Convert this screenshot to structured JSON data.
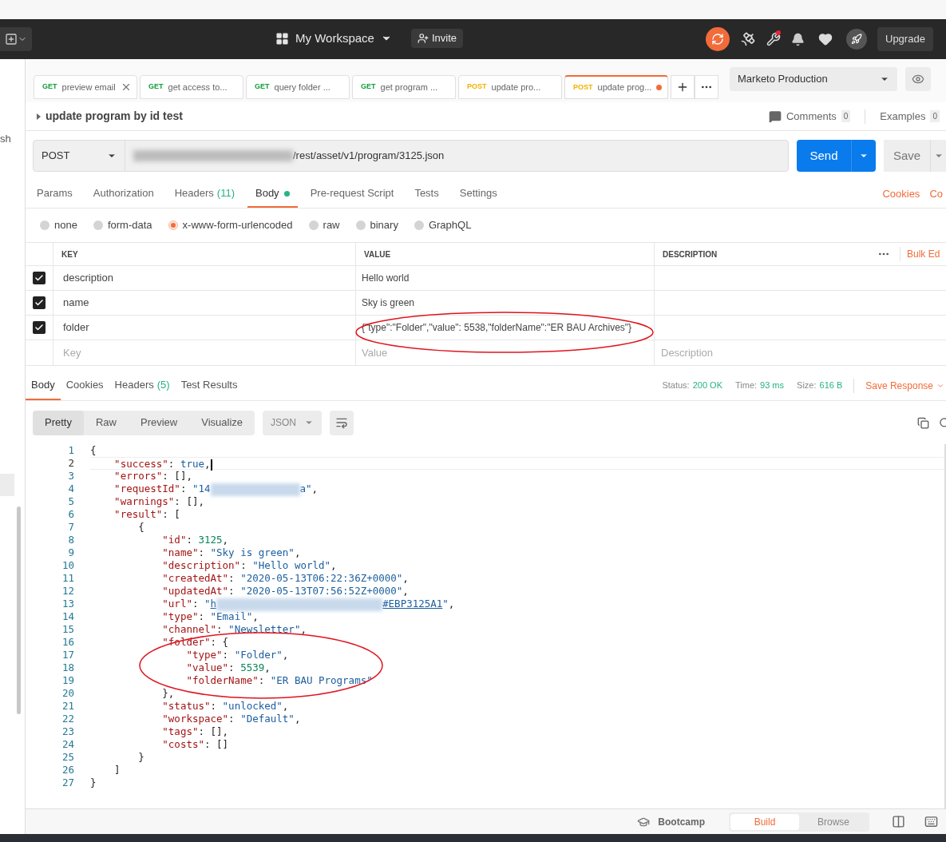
{
  "header": {
    "workspace": "My Workspace",
    "invite": "Invite",
    "upgrade": "Upgrade"
  },
  "sidebar": {
    "text": "sh"
  },
  "tabs": [
    {
      "method": "GET",
      "color": "#0e9f3a",
      "title": "preview email",
      "selected": false,
      "closable": true,
      "unsaved": false
    },
    {
      "method": "GET",
      "color": "#0e9f3a",
      "title": "get access to...",
      "selected": false,
      "closable": false,
      "unsaved": false
    },
    {
      "method": "GET",
      "color": "#0e9f3a",
      "title": "query folder ...",
      "selected": false,
      "closable": false,
      "unsaved": false
    },
    {
      "method": "GET",
      "color": "#0e9f3a",
      "title": "get program ...",
      "selected": false,
      "closable": false,
      "unsaved": false
    },
    {
      "method": "POST",
      "color": "#f2b200",
      "title": "update pro...",
      "selected": false,
      "closable": false,
      "unsaved": false
    },
    {
      "method": "POST",
      "color": "#f2b200",
      "title": "update prog...",
      "selected": true,
      "closable": false,
      "unsaved": true
    }
  ],
  "environment": "Marketo Production",
  "request": {
    "name": "update program by id test",
    "comments": "Comments",
    "comments_count": "0",
    "examples": "Examples",
    "examples_count": "0",
    "method": "POST",
    "url": "/rest/asset/v1/program/3125.json",
    "send": "Send",
    "save": "Save"
  },
  "request_tabs": [
    {
      "label": "Params",
      "selected": false
    },
    {
      "label": "Authorization",
      "selected": false
    },
    {
      "label": "Headers",
      "count": "(11)",
      "selected": false
    },
    {
      "label": "Body",
      "dot": true,
      "selected": true
    },
    {
      "label": "Pre-request Script",
      "selected": false
    },
    {
      "label": "Tests",
      "selected": false
    },
    {
      "label": "Settings",
      "selected": false
    }
  ],
  "links": [
    "Cookies",
    "Co"
  ],
  "body_types": [
    {
      "label": "none",
      "selected": false
    },
    {
      "label": "form-data",
      "selected": false
    },
    {
      "label": "x-www-form-urlencoded",
      "selected": true
    },
    {
      "label": "raw",
      "selected": false
    },
    {
      "label": "binary",
      "selected": false
    },
    {
      "label": "GraphQL",
      "selected": false
    }
  ],
  "params": {
    "columns": [
      "KEY",
      "VALUE",
      "DESCRIPTION"
    ],
    "bulk_edit": "Bulk Ed",
    "rows": [
      {
        "key": "description",
        "value": "Hello world",
        "checked": true
      },
      {
        "key": "name",
        "value": "Sky is green",
        "checked": true
      },
      {
        "key": "folder",
        "value": "{\"type\":\"Folder\",\"value\": 5538,\"folderName\":\"ER BAU Archives\"}",
        "checked": true
      }
    ],
    "new_row": [
      {
        "placeholder": "Key"
      },
      {
        "placeholder": "Value"
      },
      {
        "placeholder": "Description"
      }
    ]
  },
  "response": {
    "tabs": [
      {
        "label": "Body",
        "selected": true
      },
      {
        "label": "Cookies",
        "selected": false
      },
      {
        "label": "Headers",
        "count": "(5)",
        "selected": false
      },
      {
        "label": "Test Results",
        "selected": false
      }
    ],
    "status_label": "Status:",
    "status": "200 OK",
    "time_label": "Time:",
    "time": "93 ms",
    "size_label": "Size:",
    "size": "616 B",
    "save": "Save Response",
    "views": [
      {
        "label": "Pretty",
        "selected": true
      },
      {
        "label": "Raw",
        "selected": false
      },
      {
        "label": "Preview",
        "selected": false
      },
      {
        "label": "Visualize",
        "selected": false
      }
    ],
    "format": "JSON",
    "lines": [
      {
        "number": "1",
        "active": false,
        "tokens": [
          {
            "kind": "punct",
            "text": "{"
          }
        ]
      },
      {
        "number": "2",
        "active": true,
        "tokens": [
          {
            "kind": "key",
            "text": "    \"success\""
          },
          {
            "kind": "punct",
            "text": ": "
          },
          {
            "kind": "bool",
            "text": "true"
          },
          {
            "kind": "punct",
            "text": ","
          }
        ]
      },
      {
        "number": "3",
        "active": false,
        "tokens": [
          {
            "kind": "key",
            "text": "    \"errors\""
          },
          {
            "kind": "punct",
            "text": ": [],"
          }
        ]
      },
      {
        "number": "4",
        "active": false,
        "tokens": [
          {
            "kind": "key",
            "text": "    \"requestId\""
          },
          {
            "kind": "punct",
            "text": ": "
          },
          {
            "kind": "string",
            "text": "\"14"
          },
          {
            "kind": "redacted"
          },
          {
            "kind": "string",
            "text": "a\""
          },
          {
            "kind": "punct",
            "text": ","
          }
        ]
      },
      {
        "number": "5",
        "active": false,
        "tokens": [
          {
            "kind": "key",
            "text": "    \"warnings\""
          },
          {
            "kind": "punct",
            "text": ": [],"
          }
        ]
      },
      {
        "number": "6",
        "active": false,
        "tokens": [
          {
            "kind": "key",
            "text": "    \"result\""
          },
          {
            "kind": "punct",
            "text": ": ["
          }
        ]
      },
      {
        "number": "7",
        "active": false,
        "tokens": [
          {
            "kind": "punct",
            "text": "        {"
          }
        ]
      },
      {
        "number": "8",
        "active": false,
        "tokens": [
          {
            "kind": "key",
            "text": "            \"id\""
          },
          {
            "kind": "punct",
            "text": ": "
          },
          {
            "kind": "number",
            "text": "3125"
          },
          {
            "kind": "punct",
            "text": ","
          }
        ]
      },
      {
        "number": "9",
        "active": false,
        "tokens": [
          {
            "kind": "key",
            "text": "            \"name\""
          },
          {
            "kind": "punct",
            "text": ": "
          },
          {
            "kind": "string",
            "text": "\"Sky is green\""
          },
          {
            "kind": "punct",
            "text": ","
          }
        ]
      },
      {
        "number": "10",
        "active": false,
        "tokens": [
          {
            "kind": "key",
            "text": "            \"description\""
          },
          {
            "kind": "punct",
            "text": ": "
          },
          {
            "kind": "string",
            "text": "\"Hello world\""
          },
          {
            "kind": "punct",
            "text": ","
          }
        ]
      },
      {
        "number": "11",
        "active": false,
        "tokens": [
          {
            "kind": "key",
            "text": "            \"createdAt\""
          },
          {
            "kind": "punct",
            "text": ": "
          },
          {
            "kind": "string",
            "text": "\"2020-05-13T06:22:36Z+0000\""
          },
          {
            "kind": "punct",
            "text": ","
          }
        ]
      },
      {
        "number": "12",
        "active": false,
        "tokens": [
          {
            "kind": "key",
            "text": "            \"updatedAt\""
          },
          {
            "kind": "punct",
            "text": ": "
          },
          {
            "kind": "string",
            "text": "\"2020-05-13T07:56:52Z+0000\""
          },
          {
            "kind": "punct",
            "text": ","
          }
        ]
      },
      {
        "number": "13",
        "active": false,
        "tokens": [
          {
            "kind": "key",
            "text": "            \"url\""
          },
          {
            "kind": "punct",
            "text": ": "
          },
          {
            "kind": "string",
            "text": "\""
          },
          {
            "kind": "link",
            "text": "h"
          },
          {
            "kind": "redacted_link"
          },
          {
            "kind": "link",
            "text": "#EBP3125A1"
          },
          {
            "kind": "string",
            "text": "\""
          },
          {
            "kind": "punct",
            "text": ","
          }
        ]
      },
      {
        "number": "14",
        "active": false,
        "tokens": [
          {
            "kind": "key",
            "text": "            \"type\""
          },
          {
            "kind": "punct",
            "text": ": "
          },
          {
            "kind": "string",
            "text": "\"Email\""
          },
          {
            "kind": "punct",
            "text": ","
          }
        ]
      },
      {
        "number": "15",
        "active": false,
        "tokens": [
          {
            "kind": "key",
            "text": "            \"channel\""
          },
          {
            "kind": "punct",
            "text": ": "
          },
          {
            "kind": "string",
            "text": "\"Newsletter\""
          },
          {
            "kind": "punct",
            "text": ","
          }
        ]
      },
      {
        "number": "16",
        "active": false,
        "tokens": [
          {
            "kind": "key",
            "text": "            \"folder\""
          },
          {
            "kind": "punct",
            "text": ": {"
          }
        ]
      },
      {
        "number": "17",
        "active": false,
        "tokens": [
          {
            "kind": "key",
            "text": "                \"type\""
          },
          {
            "kind": "punct",
            "text": ": "
          },
          {
            "kind": "string",
            "text": "\"Folder\""
          },
          {
            "kind": "punct",
            "text": ","
          }
        ]
      },
      {
        "number": "18",
        "active": false,
        "tokens": [
          {
            "kind": "key",
            "text": "                \"value\""
          },
          {
            "kind": "punct",
            "text": ": "
          },
          {
            "kind": "number",
            "text": "5539"
          },
          {
            "kind": "punct",
            "text": ","
          }
        ]
      },
      {
        "number": "19",
        "active": false,
        "tokens": [
          {
            "kind": "key",
            "text": "                \"folderName\""
          },
          {
            "kind": "punct",
            "text": ": "
          },
          {
            "kind": "string",
            "text": "\"ER BAU Programs\""
          }
        ]
      },
      {
        "number": "20",
        "active": false,
        "tokens": [
          {
            "kind": "punct",
            "text": "            },"
          }
        ]
      },
      {
        "number": "21",
        "active": false,
        "tokens": [
          {
            "kind": "key",
            "text": "            \"status\""
          },
          {
            "kind": "punct",
            "text": ": "
          },
          {
            "kind": "string",
            "text": "\"unlocked\""
          },
          {
            "kind": "punct",
            "text": ","
          }
        ]
      },
      {
        "number": "22",
        "active": false,
        "tokens": [
          {
            "kind": "key",
            "text": "            \"workspace\""
          },
          {
            "kind": "punct",
            "text": ": "
          },
          {
            "kind": "string",
            "text": "\"Default\""
          },
          {
            "kind": "punct",
            "text": ","
          }
        ]
      },
      {
        "number": "23",
        "active": false,
        "tokens": [
          {
            "kind": "key",
            "text": "            \"tags\""
          },
          {
            "kind": "punct",
            "text": ": [],"
          }
        ]
      },
      {
        "number": "24",
        "active": false,
        "tokens": [
          {
            "kind": "key",
            "text": "            \"costs\""
          },
          {
            "kind": "punct",
            "text": ": []"
          }
        ]
      },
      {
        "number": "25",
        "active": false,
        "tokens": [
          {
            "kind": "punct",
            "text": "        }"
          }
        ]
      },
      {
        "number": "26",
        "active": false,
        "tokens": [
          {
            "kind": "punct",
            "text": "    ]"
          }
        ]
      },
      {
        "number": "27",
        "active": false,
        "tokens": [
          {
            "kind": "punct",
            "text": "}"
          }
        ]
      }
    ]
  },
  "footer": {
    "bootcamp": "Bootcamp",
    "modes": [
      {
        "label": "Build",
        "selected": true
      },
      {
        "label": "Browse",
        "selected": false
      }
    ]
  }
}
